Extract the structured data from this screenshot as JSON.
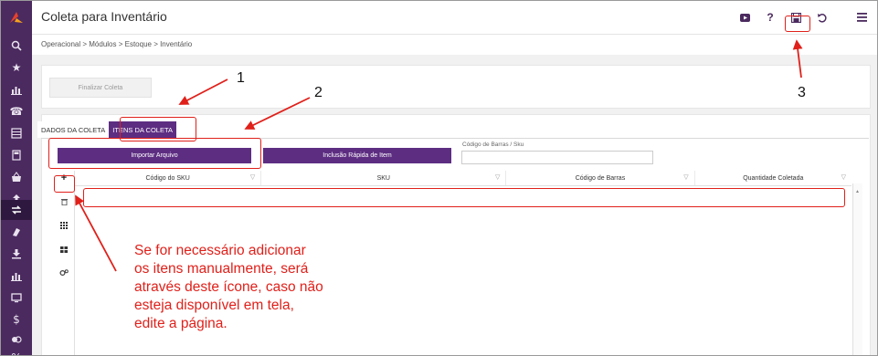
{
  "header": {
    "title": "Coleta para Inventário",
    "icons": [
      "youtube-icon",
      "help-icon",
      "save-icon",
      "undo-icon",
      "menu-icon"
    ],
    "help_label": "?"
  },
  "breadcrumb": "Operacional > Módulos > Estoque > Inventário",
  "sidebar": {
    "icons": [
      "search-icon",
      "star-icon",
      "chart-icon",
      "phone-icon",
      "list-icon",
      "calculator-icon",
      "basket-icon",
      "upload-icon",
      "exchange-icon",
      "tag-icon",
      "download-icon",
      "bar-chart-icon",
      "monitor-icon",
      "dollar-icon",
      "handshake-icon",
      "percent-icon"
    ],
    "active_index": 9
  },
  "actions": {
    "finalizar_label": "Finalizar Coleta"
  },
  "tabs": [
    {
      "label": "DADOS DA COLETA",
      "active": false
    },
    {
      "label": "ITENS DA COLETA",
      "active": true
    }
  ],
  "buttons": {
    "importar_label": "Importar Arquivo",
    "inclusao_label": "Inclusão Rápida de Item"
  },
  "barcode": {
    "label": "Código de Barras / Sku",
    "value": ""
  },
  "grid": {
    "columns": [
      "Código do SKU",
      "SKU",
      "Código de Barras",
      "Quantidade Coletada"
    ],
    "rows": []
  },
  "toolbar_icons": [
    "add-icon",
    "trash-icon",
    "grid-icon",
    "blocks-icon",
    "settings-icon"
  ],
  "annotations": {
    "n1": "1",
    "n2": "2",
    "n3": "3",
    "note_lines": [
      "Se for necessário adicionar",
      "os itens manualmente, será",
      "através deste ícone, caso não",
      "esteja disponível em tela,",
      "edite a página."
    ]
  },
  "colors": {
    "sidebar": "#4b2a5f",
    "accent": "#5d2d82",
    "annotation": "#e0201a"
  }
}
